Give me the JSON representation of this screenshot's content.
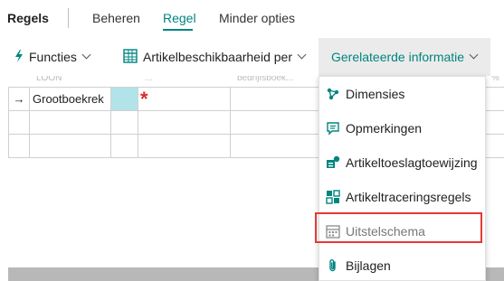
{
  "tabs": {
    "title": "Regels",
    "items": [
      {
        "label": "Beheren"
      },
      {
        "label": "Regel"
      },
      {
        "label": "Minder opties"
      }
    ]
  },
  "toolbar": {
    "functions_label": "Functies",
    "availability_label": "Artikelbeschikbaarheid per",
    "related_label": "Gerelateerde informatie"
  },
  "grid": {
    "ghost_headers": [
      "LOON",
      "...",
      "bedrijfsboek...",
      "%"
    ],
    "rows": [
      {
        "marker": "→",
        "account": "Grootboekrek",
        "required": "*"
      },
      {
        "marker": "",
        "account": "",
        "required": ""
      },
      {
        "marker": "",
        "account": "",
        "required": ""
      }
    ]
  },
  "menu": {
    "items": [
      {
        "label": "Dimensies",
        "icon": "dimensions-icon"
      },
      {
        "label": "Opmerkingen",
        "icon": "comments-icon"
      },
      {
        "label": "Artikeltoeslagtoewijzing",
        "icon": "item-charge-assignment-icon"
      },
      {
        "label": "Artikeltraceringsregels",
        "icon": "item-tracking-icon"
      },
      {
        "label": "Uitstelschema",
        "icon": "deferral-schedule-icon"
      },
      {
        "label": "Bijlagen",
        "icon": "paperclip-icon"
      }
    ]
  },
  "colors": {
    "accent": "#00857f",
    "highlight": "#e53935",
    "selected_cell": "#b2e3e8",
    "required": "#d32f2f"
  }
}
